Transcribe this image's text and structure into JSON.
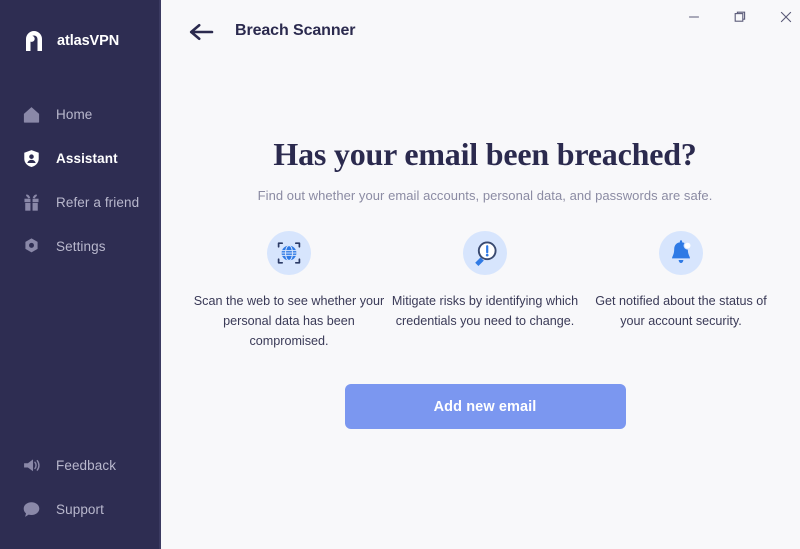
{
  "colors": {
    "sidebar_bg": "#2e2d52",
    "main_bg": "#f8f8fa",
    "accent_button": "#7b97f0",
    "icon_blue": "#2f7ae5",
    "icon_circle_bg": "#d7e5fd",
    "title_text": "#2b2a4e",
    "nav_inactive": "#b9b8cd",
    "nav_active": "#ffffff",
    "subhead_text": "#8b8ba3"
  },
  "sidebar": {
    "brand": {
      "name": "atlasVPN",
      "logo_icon": "atlas-arch-logo-icon"
    },
    "top_items": [
      {
        "label": "Home",
        "icon": "home-icon",
        "active": false
      },
      {
        "label": "Assistant",
        "icon": "shield-person-icon",
        "active": true
      },
      {
        "label": "Refer a friend",
        "icon": "gift-icon",
        "active": false
      },
      {
        "label": "Settings",
        "icon": "gear-icon",
        "active": false
      }
    ],
    "bottom_items": [
      {
        "label": "Feedback",
        "icon": "megaphone-icon",
        "active": false
      },
      {
        "label": "Support",
        "icon": "speech-bubble-icon",
        "active": false
      }
    ]
  },
  "titlebar": {
    "back_icon": "arrow-left-icon",
    "title": "Breach Scanner",
    "window_controls": [
      {
        "name": "minimize",
        "icon": "minimize-icon"
      },
      {
        "name": "maximize",
        "icon": "restore-icon"
      },
      {
        "name": "close",
        "icon": "close-icon"
      }
    ]
  },
  "main": {
    "headline": "Has your email been breached?",
    "subhead": "Find out whether your email accounts, personal data, and passwords are safe.",
    "features": [
      {
        "icon": "globe-scan-icon",
        "text": "Scan the web to see whether your personal data has been compromised."
      },
      {
        "icon": "magnifier-alert-icon",
        "text": "Mitigate risks by identifying which credentials you need to change."
      },
      {
        "icon": "bell-notification-icon",
        "text": "Get notified about the status of your account security."
      }
    ],
    "cta_label": "Add new email"
  }
}
